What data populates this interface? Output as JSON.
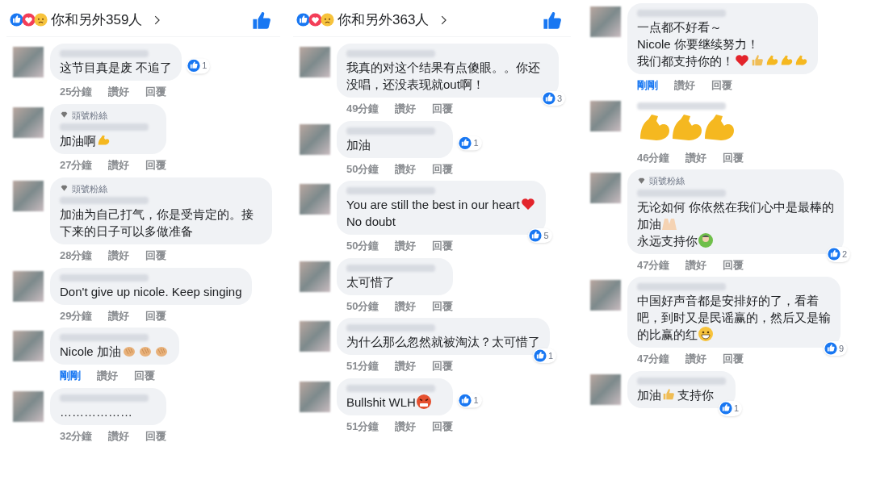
{
  "panels": [
    {
      "header": {
        "reactions": [
          {
            "kind": "like"
          },
          {
            "kind": "love"
          },
          {
            "kind": "sad"
          }
        ],
        "summary": "你和另外359人"
      },
      "comments": [
        {
          "lines": [
            {
              "text": "这节目真是废 不追了"
            }
          ],
          "likes": "1",
          "time": "25分鐘",
          "time_highlighted": false,
          "like": "讚好",
          "reply": "回覆"
        },
        {
          "badge": "頭號粉絲",
          "lines": [
            {
              "text": "加油啊",
              "emojis": [
                {
                  "kind": "muscle"
                }
              ]
            }
          ],
          "time": "27分鐘",
          "time_highlighted": false,
          "like": "讚好",
          "reply": "回覆"
        },
        {
          "badge": "頭號粉絲",
          "lines": [
            {
              "text": "加油为自己打气，你是受肯定的。接下来的日子可以多做准备"
            }
          ],
          "time": "28分鐘",
          "time_highlighted": false,
          "like": "讚好",
          "reply": "回覆"
        },
        {
          "lines": [
            {
              "text": "Don't give up nicole. Keep singing"
            }
          ],
          "time": "29分鐘",
          "time_highlighted": false,
          "like": "讚好",
          "reply": "回覆"
        },
        {
          "lines": [
            {
              "text": "Nicole 加油",
              "emojis": [
                {
                  "kind": "clap"
                },
                {
                  "kind": "clap"
                },
                {
                  "kind": "clap"
                }
              ]
            }
          ],
          "time": "剛剛",
          "time_highlighted": true,
          "like": "讚好",
          "reply": "回覆"
        },
        {
          "lines": [
            {
              "text": "………………"
            }
          ],
          "time": "32分鐘",
          "time_highlighted": false,
          "like": "讚好",
          "reply": "回覆"
        }
      ]
    },
    {
      "header": {
        "reactions": [
          {
            "kind": "like"
          },
          {
            "kind": "love"
          },
          {
            "kind": "sad"
          }
        ],
        "summary": "你和另外363人"
      },
      "comments": [
        {
          "lines": [
            {
              "text": "我真的对这个结果有点傻眼。。你还没唱，还没表现就out啊！"
            }
          ],
          "likes": "3",
          "time": "49分鐘",
          "time_highlighted": false,
          "like": "讚好",
          "reply": "回覆"
        },
        {
          "lines": [
            {
              "text": "加油"
            }
          ],
          "likes": "1",
          "time": "50分鐘",
          "time_highlighted": false,
          "like": "讚好",
          "reply": "回覆"
        },
        {
          "lines": [
            {
              "text": "You are still the best in our heart",
              "emojis": [
                {
                  "kind": "heart"
                }
              ]
            },
            {
              "text": "No doubt"
            }
          ],
          "likes": "5",
          "time": "50分鐘",
          "time_highlighted": false,
          "like": "讚好",
          "reply": "回覆"
        },
        {
          "lines": [
            {
              "text": "太可惜了"
            }
          ],
          "time": "50分鐘",
          "time_highlighted": false,
          "like": "讚好",
          "reply": "回覆"
        },
        {
          "lines": [
            {
              "text": "为什么那么忽然就被淘汰？太可惜了"
            }
          ],
          "likes": "1",
          "time": "51分鐘",
          "time_highlighted": false,
          "like": "讚好",
          "reply": "回覆"
        },
        {
          "lines": [
            {
              "text": "Bullshit WLH",
              "emojis": [
                {
                  "kind": "angry"
                }
              ]
            }
          ],
          "likes": "1",
          "time": "51分鐘",
          "time_highlighted": false,
          "like": "讚好",
          "reply": "回覆"
        }
      ]
    },
    {
      "comments": [
        {
          "lines": [
            {
              "text": "一点都不好看～"
            },
            {
              "text": "Nicole 你要继续努力！"
            },
            {
              "text": "我们都支持你的！",
              "emojis": [
                {
                  "kind": "heart"
                },
                {
                  "kind": "thumb"
                },
                {
                  "kind": "muscle"
                },
                {
                  "kind": "muscle"
                },
                {
                  "kind": "muscle"
                }
              ]
            }
          ],
          "time": "剛剛",
          "time_highlighted": true,
          "like": "讚好",
          "reply": "回覆"
        },
        {
          "bubble": false,
          "lines": [
            {
              "emojis": [
                {
                  "kind": "big-muscle"
                },
                {
                  "kind": "big-muscle"
                },
                {
                  "kind": "big-muscle"
                }
              ]
            }
          ],
          "time": "46分鐘",
          "time_highlighted": false,
          "like": "讚好",
          "reply": "回覆"
        },
        {
          "badge": "頭號粉絲",
          "lines": [
            {
              "text": "无论如何 你依然在我们心中是最棒的"
            },
            {
              "text": "加油",
              "emojis": [
                {
                  "kind": "hands"
                }
              ]
            },
            {
              "text": "永远支持你",
              "emojis": [
                {
                  "kind": "person"
                }
              ]
            }
          ],
          "likes": "2",
          "time": "47分鐘",
          "time_highlighted": false,
          "like": "讚好",
          "reply": "回覆"
        },
        {
          "lines": [
            {
              "text": "中国好声音都是安排好的了，看着"
            },
            {
              "text": "吧，到时又是民谣赢的，然后又是输"
            },
            {
              "text": "的比赢的红",
              "emojis": [
                {
                  "kind": "grin"
                }
              ]
            }
          ],
          "likes": "9",
          "time": "47分鐘",
          "time_highlighted": false,
          "like": "讚好",
          "reply": "回覆"
        },
        {
          "lines": [
            {
              "text": "加油",
              "emojis": [
                {
                  "kind": "thumb"
                }
              ]
            },
            {
              "text": "支持你",
              "inline": true
            }
          ],
          "likes": "1"
        }
      ]
    }
  ]
}
